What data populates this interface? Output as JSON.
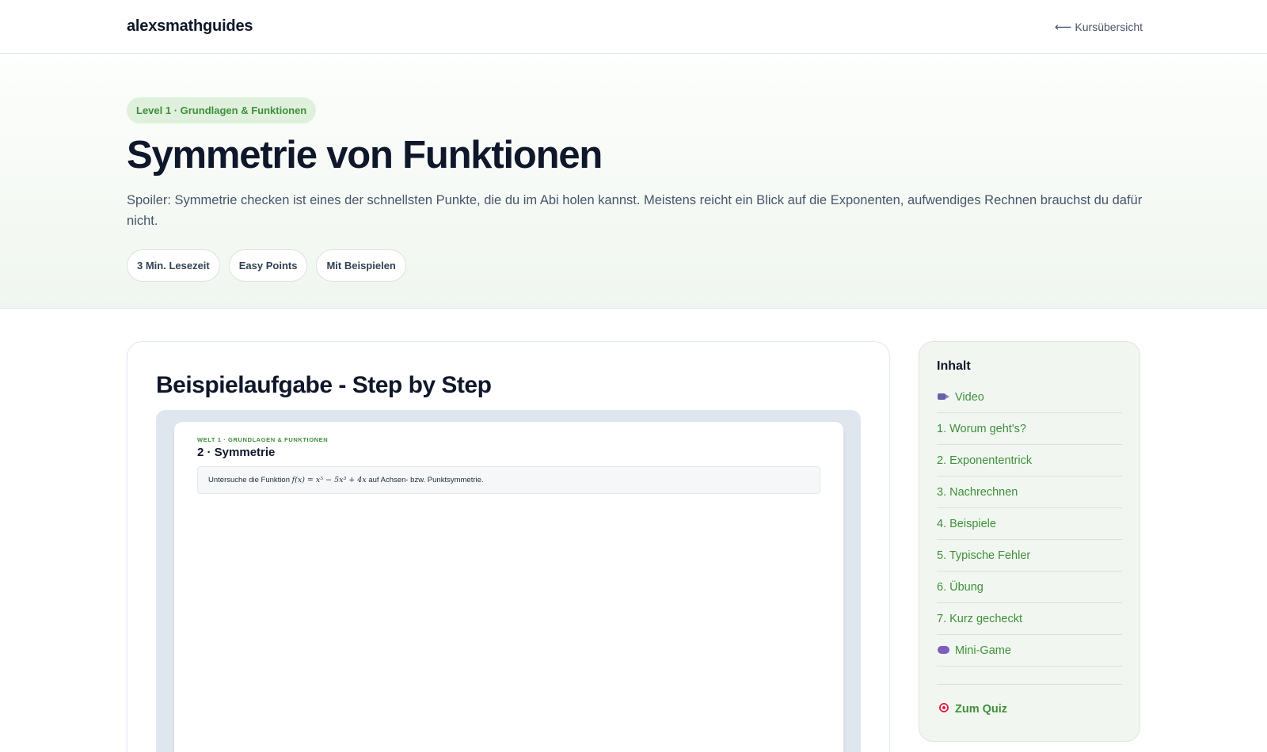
{
  "header": {
    "brand": "alexsmathguides",
    "back_link": "Kursübersicht",
    "back_arrow": "⟵"
  },
  "hero": {
    "level_badge": "Level 1 · Grundlagen & Funktionen",
    "title": "Symmetrie von Funktionen",
    "description": "Spoiler: Symmetrie checken ist eines der schnellsten Punkte, die du im Abi holen kannst. Meistens reicht ein Blick auf die Exponenten, aufwendiges Rechnen brauchst du dafür nicht.",
    "meta_pills": [
      "3 Min. Lesezeit",
      "Easy Points",
      "Mit Beispielen"
    ]
  },
  "article": {
    "section_title": "Beispielaufgabe - Step by Step",
    "video": {
      "kicker": "WELT 1 · GRUNDLAGEN & FUNKTIONEN",
      "slide_title": "2 · Symmetrie",
      "task_prefix": "Untersuche die Funktion",
      "task_formula": "f(x) = x⁵ − 5x³ + 4x",
      "task_suffix": "auf Achsen- bzw. Punktsymmetrie."
    }
  },
  "toc": {
    "heading": "Inhalt",
    "items": [
      {
        "label": "Video",
        "icon": "video-camera-icon"
      },
      {
        "label": "1. Worum geht's?"
      },
      {
        "label": "2. Exponententrick"
      },
      {
        "label": "3. Nachrechnen"
      },
      {
        "label": "4. Beispiele"
      },
      {
        "label": "5. Typische Fehler"
      },
      {
        "label": "6. Übung"
      },
      {
        "label": "7. Kurz gecheckt"
      },
      {
        "label": "Mini-Game",
        "icon": "game-controller-icon"
      }
    ],
    "quiz_label": "Zum Quiz",
    "quiz_icon": "target-icon"
  }
}
